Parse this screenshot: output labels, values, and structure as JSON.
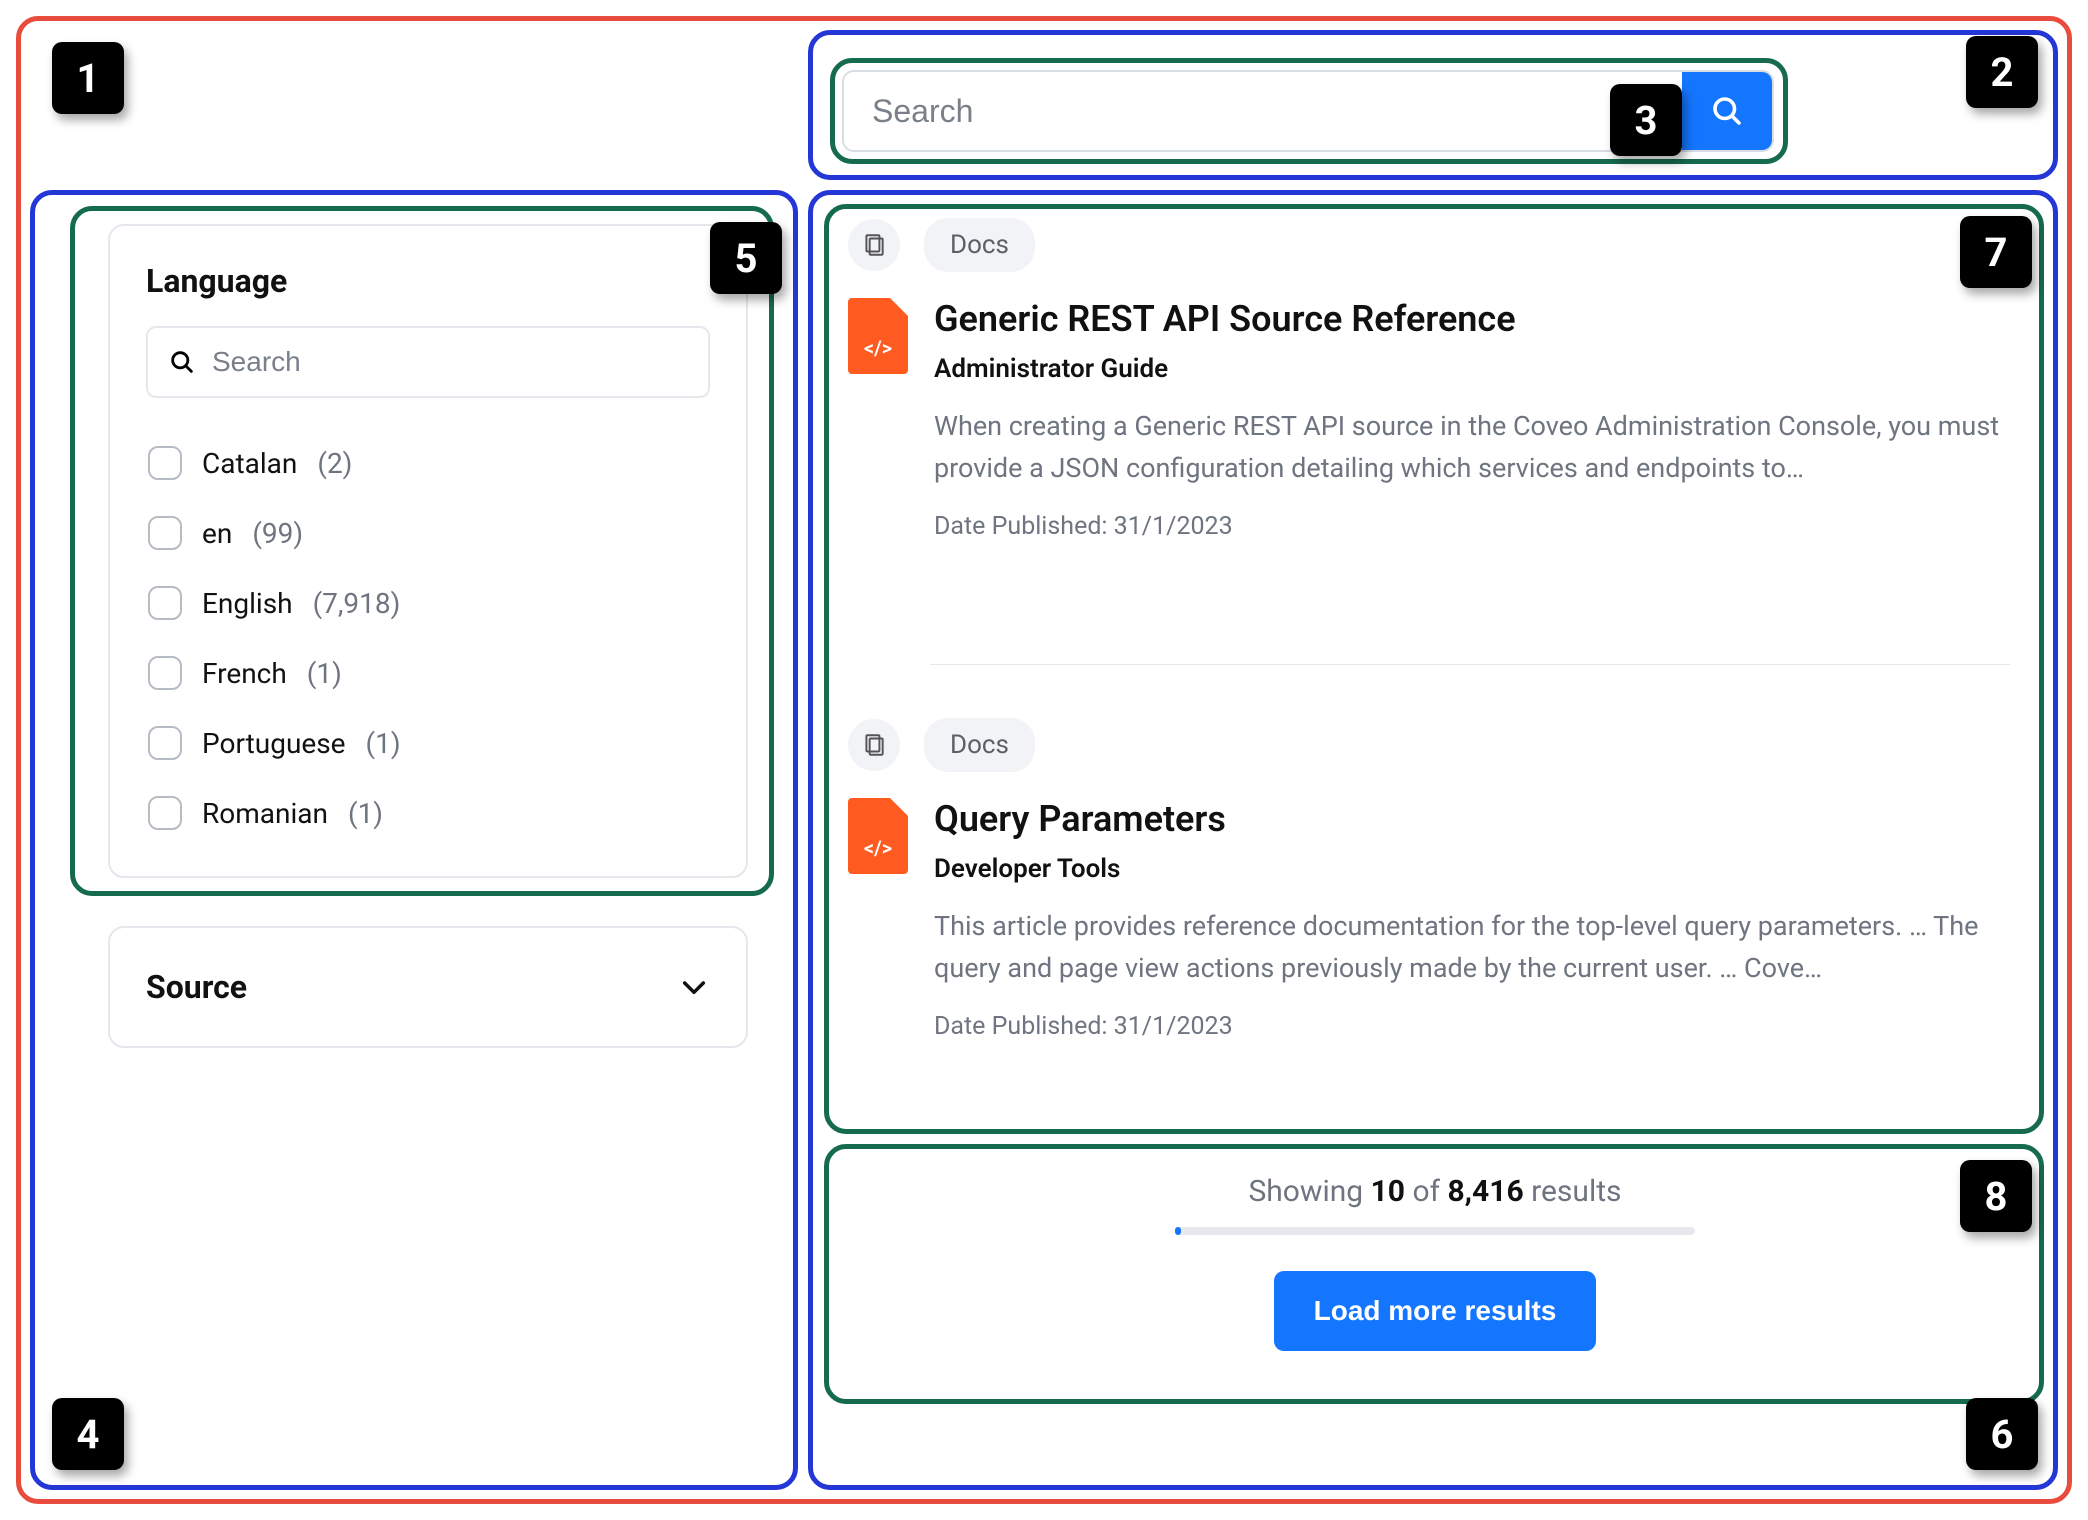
{
  "markers": [
    "1",
    "2",
    "3",
    "4",
    "5",
    "6",
    "7",
    "8"
  ],
  "search": {
    "placeholder": "Search"
  },
  "facets": {
    "language": {
      "title": "Language",
      "search_placeholder": "Search",
      "items": [
        {
          "label": "Catalan",
          "count": "(2)"
        },
        {
          "label": "en",
          "count": "(99)"
        },
        {
          "label": "English",
          "count": "(7,918)"
        },
        {
          "label": "French",
          "count": "(1)"
        },
        {
          "label": "Portuguese",
          "count": "(1)"
        },
        {
          "label": "Romanian",
          "count": "(1)"
        }
      ]
    },
    "source": {
      "title": "Source"
    }
  },
  "results": [
    {
      "badge": "Docs",
      "icon_label": "</>",
      "title": "Generic REST API Source Reference",
      "subtitle": "Administrator Guide",
      "excerpt": "When creating a Generic REST API source in the Coveo Administration Console, you must provide a JSON configuration detailing which services and endpoints to…",
      "date": "Date Published: 31/1/2023"
    },
    {
      "badge": "Docs",
      "icon_label": "</>",
      "title": "Query Parameters",
      "subtitle": "Developer Tools",
      "excerpt": "This article provides reference documentation for the top-level query parameters. … The query and page view actions previously made by the current user. … Cove…",
      "date": "Date Published: 31/1/2023"
    }
  ],
  "loadmore": {
    "showing": "Showing ",
    "count": "10",
    "of": " of ",
    "total": "8,416",
    "tail": " results",
    "button": "Load more results"
  }
}
